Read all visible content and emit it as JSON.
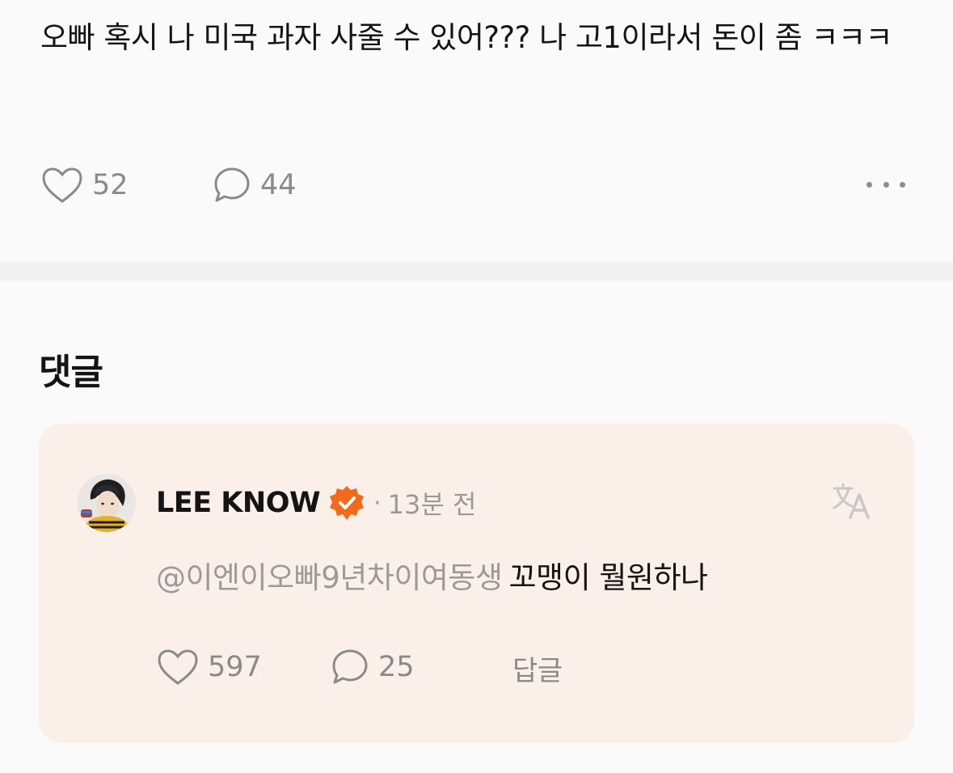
{
  "post": {
    "text": "오빠 혹시 나 미국 과자 사줄 수 있어??? 나 고1이라서 돈이 좀 ㅋㅋㅋ",
    "like_count": "52",
    "comment_count": "44",
    "icons": {
      "like": "heart-icon",
      "comment": "comment-bubble-icon",
      "more": "more-horizontal-icon"
    }
  },
  "comments_section": {
    "heading": "댓글"
  },
  "comment": {
    "author": "LEE KNOW",
    "separator": "·",
    "time": "13분 전",
    "mention": "@이엔이오빠9년차이여동생",
    "body": "꼬맹이 뭘원하나",
    "like_count": "597",
    "reply_count": "25",
    "reply_label": "답글",
    "icons": {
      "verified": "verified-badge-icon",
      "translate": "translate-icon",
      "like": "heart-icon",
      "comment": "comment-bubble-icon"
    }
  },
  "colors": {
    "background": "#fafafa",
    "divider": "#f1f1f1",
    "comment_card": "#fbefe9",
    "verified_badge": "#f26a1b",
    "muted_text": "#9a9a9a",
    "primary_text": "#141414"
  }
}
